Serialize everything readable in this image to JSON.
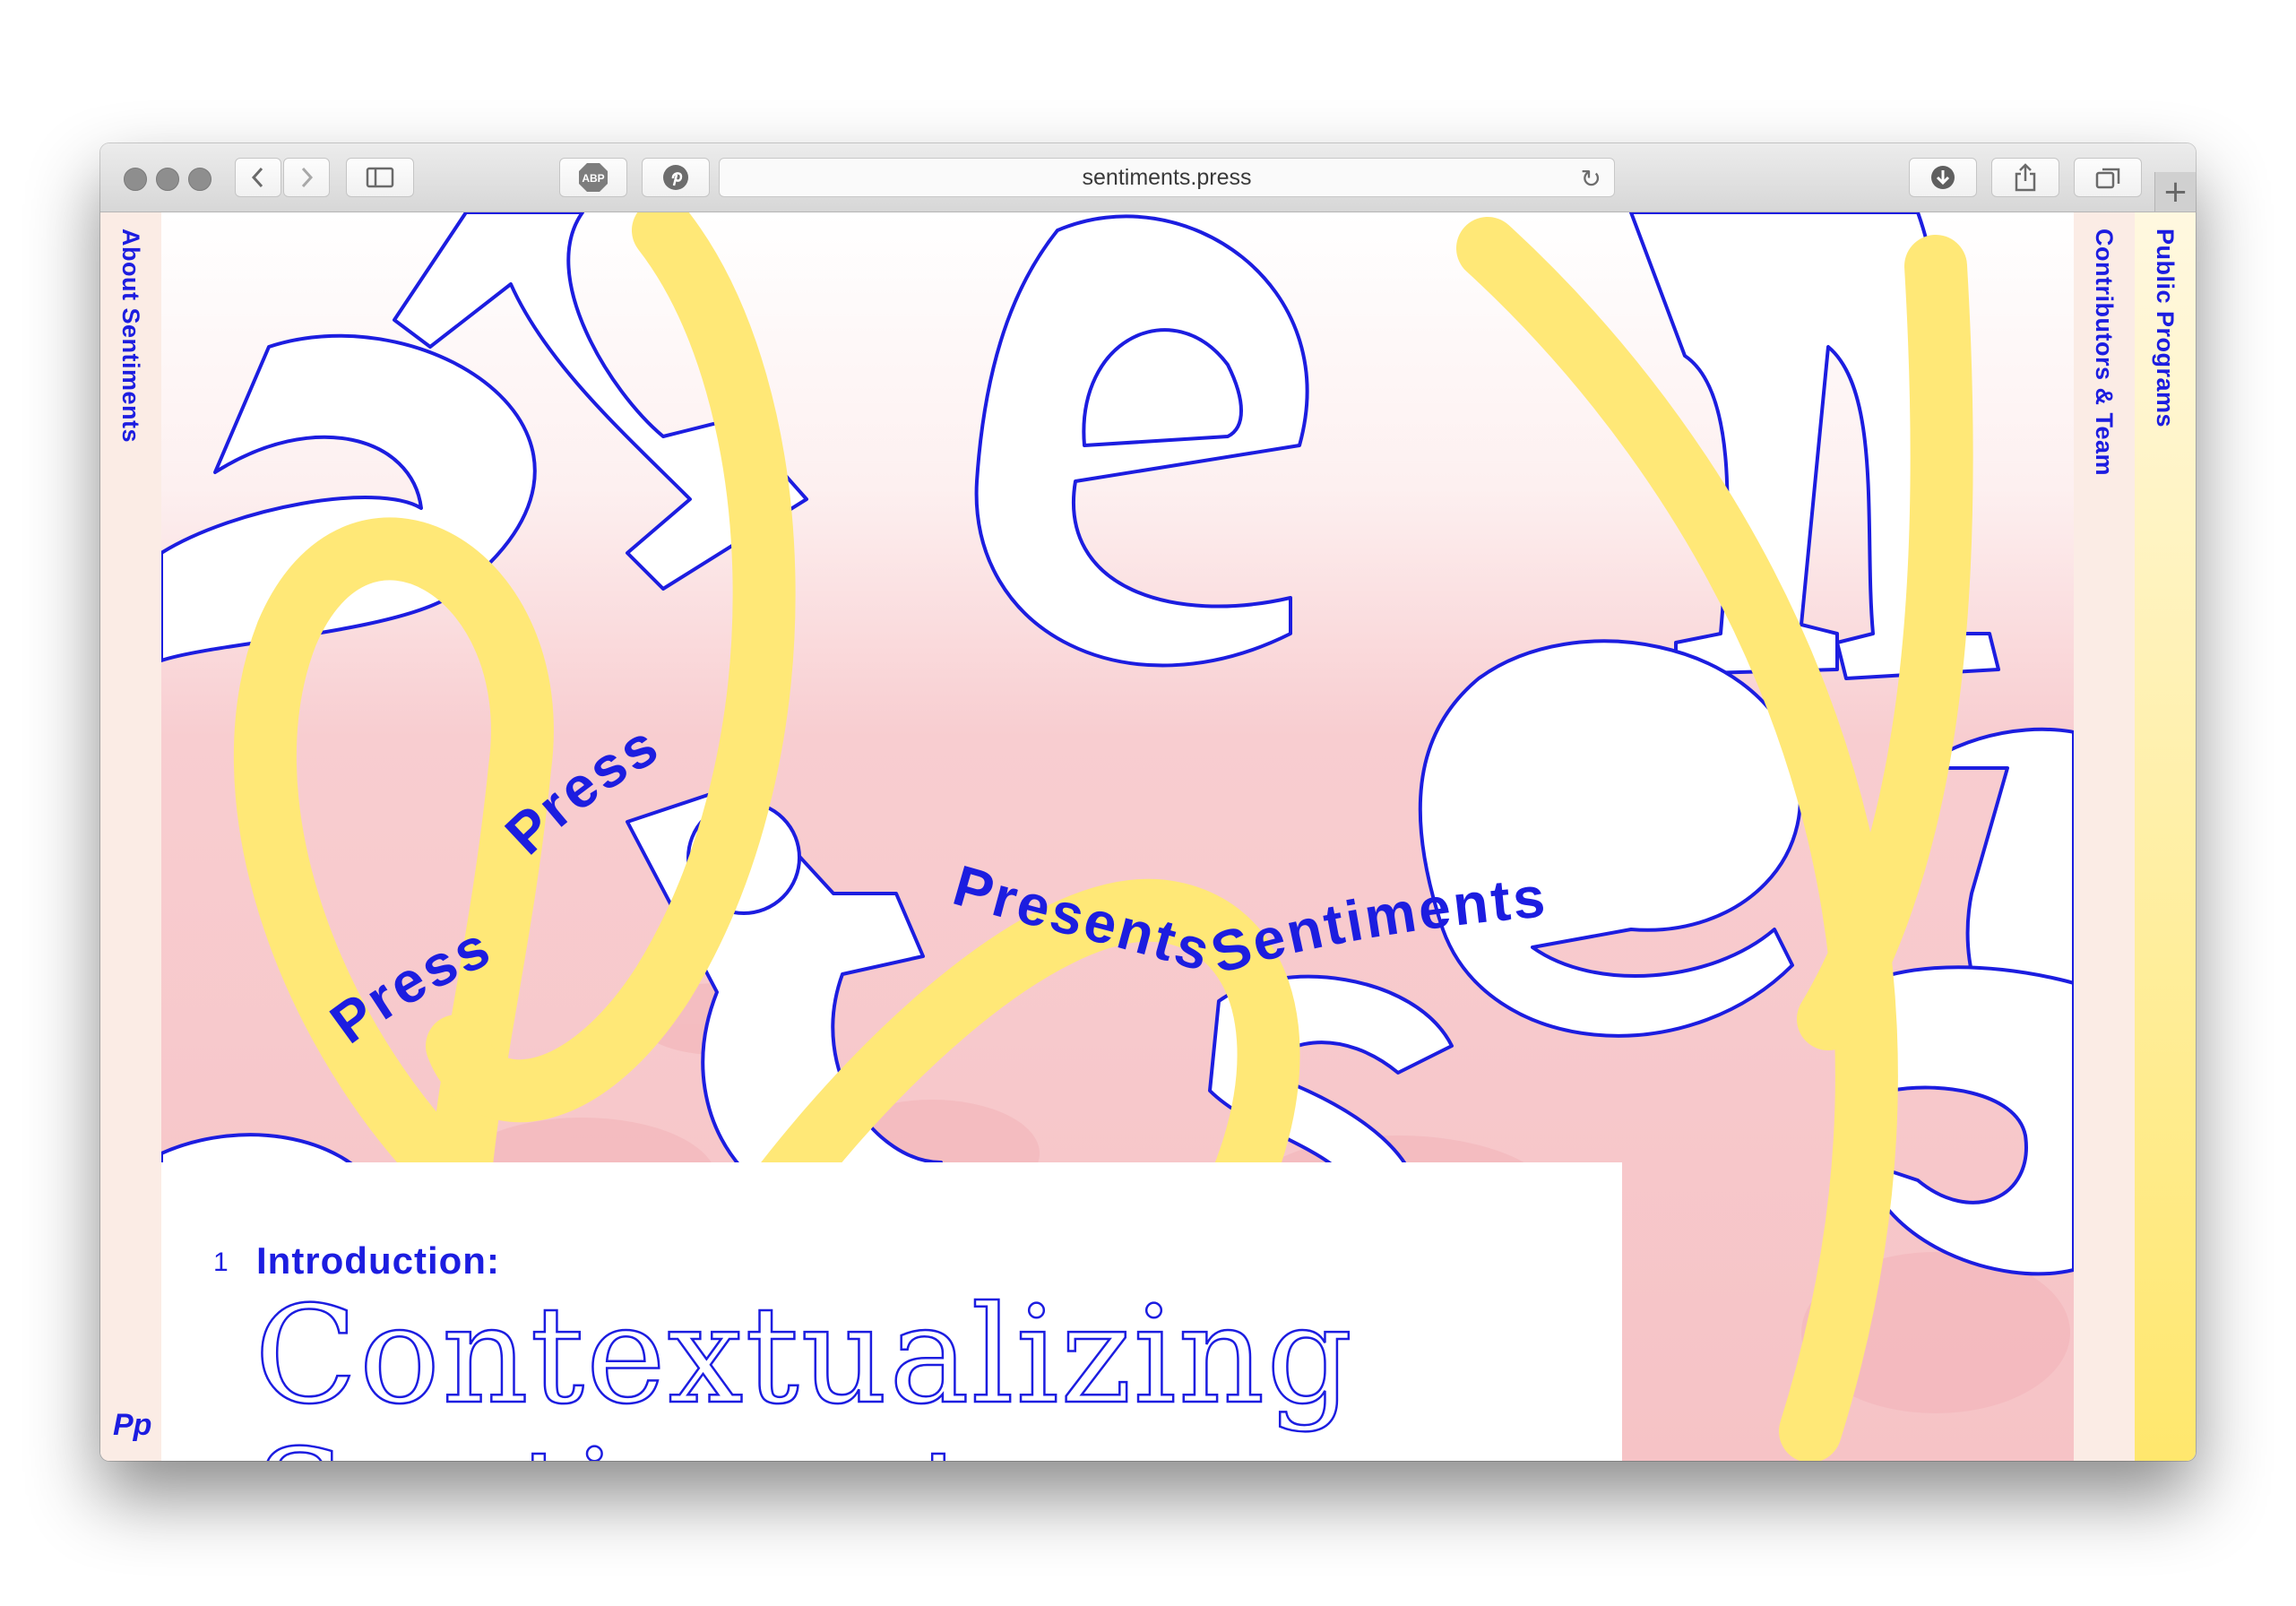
{
  "browser": {
    "url": "sentiments.press",
    "toolbar_icons": [
      "back-chevron",
      "forward-chevron",
      "sidebar",
      "adblock-abp",
      "pinterest",
      "reload",
      "downloads",
      "share",
      "tabs",
      "new-tab-plus"
    ],
    "abp_label": "ABP"
  },
  "nav": {
    "left_link": "About Sentiments",
    "right_link_1": "Contributors & Team",
    "right_link_2": "Public Programs",
    "logo": "Pp"
  },
  "hero": {
    "curved_words": [
      "Press",
      "Press",
      "Presents",
      "Sentiments"
    ]
  },
  "intro": {
    "number": "1",
    "label": "Introduction:",
    "title": "Contextualizing Sentiments"
  },
  "colors": {
    "accent_blue": "#1c1de0",
    "yellow": "#ffe877",
    "pink": "#f7c6c8",
    "rail": "#fbece5"
  }
}
